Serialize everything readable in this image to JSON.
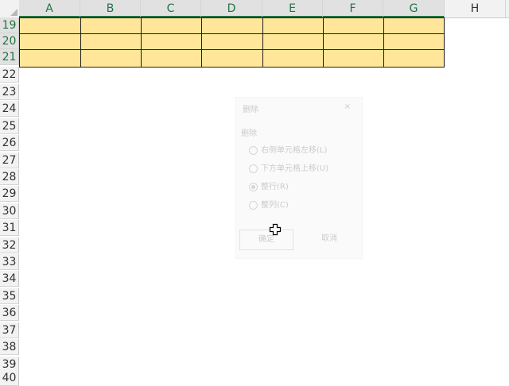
{
  "columns": [
    "A",
    "B",
    "C",
    "D",
    "E",
    "F",
    "G",
    "H"
  ],
  "rows": [
    "19",
    "20",
    "21",
    "22",
    "23",
    "24",
    "25",
    "26",
    "27",
    "28",
    "29",
    "30",
    "31",
    "32",
    "33",
    "34",
    "35",
    "36",
    "37",
    "38",
    "39",
    "40"
  ],
  "colors": {
    "cell_fill": "#ffe699",
    "header_accent": "#217346"
  },
  "dialog": {
    "title": "删除",
    "close": "×",
    "group_label": "删除",
    "options": [
      {
        "label": "右侧单元格左移(L)",
        "checked": false
      },
      {
        "label": "下方单元格上移(U)",
        "checked": false
      },
      {
        "label": "整行(R)",
        "checked": true
      },
      {
        "label": "整列(C)",
        "checked": false
      }
    ],
    "ok_label": "确定",
    "cancel_label": "取消"
  }
}
